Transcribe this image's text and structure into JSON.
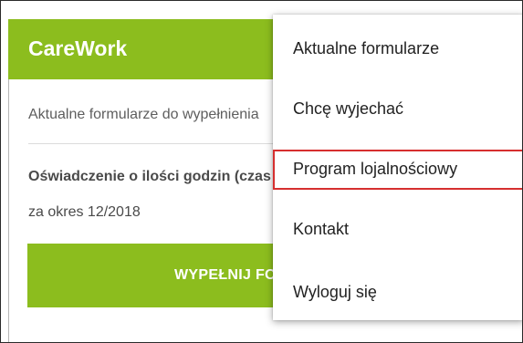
{
  "app": {
    "title": "CareWork"
  },
  "main": {
    "subtitle": "Aktualne formularze do wypełnienia",
    "form": {
      "title": "Oświadczenie o ilości godzin (czas pracy)",
      "period": "za okres 12/2018",
      "button_label": "WYPEŁNIJ FORMULARZ"
    }
  },
  "menu": {
    "items": [
      {
        "label": "Aktualne formularze"
      },
      {
        "label": "Chcę wyjechać"
      },
      {
        "label": "Program lojalnościowy",
        "highlighted": true
      },
      {
        "label": "Kontakt"
      },
      {
        "label": "Wyloguj się"
      }
    ]
  },
  "colors": {
    "accent": "#8cbd1e",
    "highlight_border": "#d62f2f"
  }
}
